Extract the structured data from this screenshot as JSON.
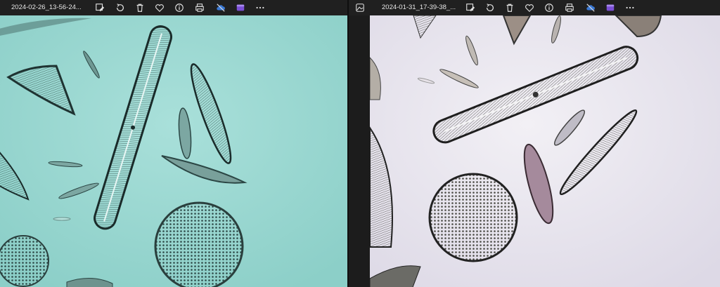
{
  "left_window": {
    "filename": "2024-02-26_13-56-24...",
    "toolbar_icons": [
      "edit-image-icon",
      "rotate-icon",
      "delete-icon",
      "favorite-heart-icon",
      "info-icon",
      "print-icon",
      "cloud-sync-off-icon",
      "clipchamp-icon",
      "more-options-icon"
    ],
    "photo_description_bg": "#9fd8d2"
  },
  "right_window": {
    "filename": "2024-01-31_17-39-38_...",
    "toolbar_icons": [
      "edit-image-icon",
      "rotate-icon",
      "delete-icon",
      "favorite-heart-icon",
      "info-icon",
      "print-icon",
      "cloud-sync-off-icon",
      "clipchamp-icon",
      "more-options-icon"
    ],
    "photo_description_bg": "#e6e2ee"
  },
  "colors": {
    "titlebar": "#202020",
    "icon": "#e0e0e0",
    "accent_purple": "#7b4fd6"
  }
}
